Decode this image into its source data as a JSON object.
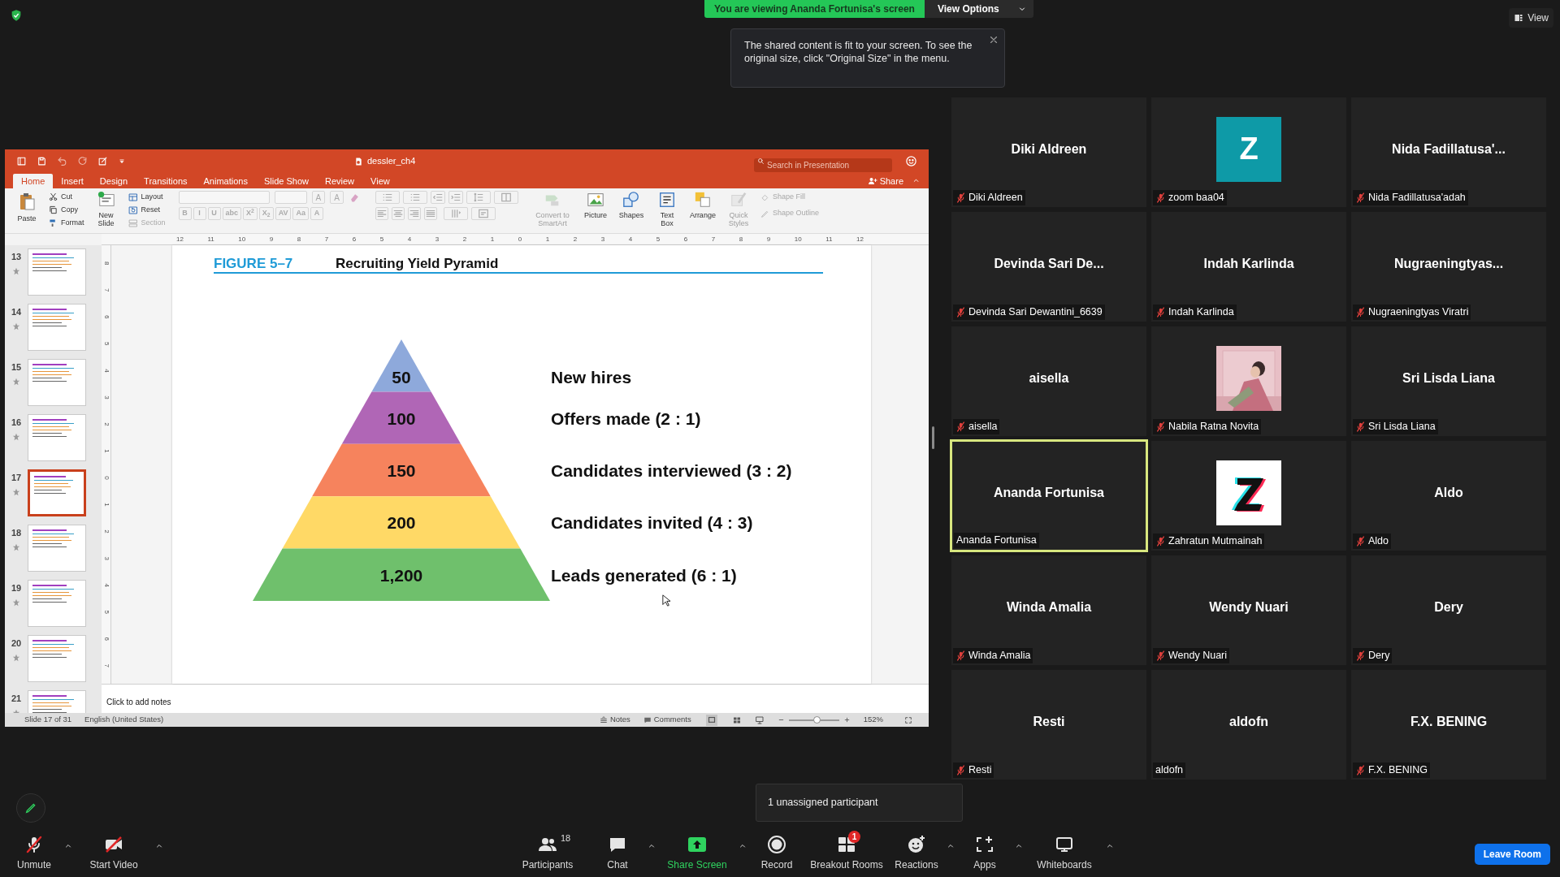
{
  "share_banner": {
    "text": "You are viewing Ananda Fortunisa's screen",
    "view_options": "View Options"
  },
  "notice": {
    "text": "The shared content is fit to your screen. To see the original size, click \"Original Size\" in the menu."
  },
  "view_button": "View",
  "presentation": {
    "title": "dessler_ch4",
    "search": {
      "placeholder": "Search in Presentation"
    },
    "tabs": [
      {
        "label": "Home",
        "selected": true
      },
      {
        "label": "Insert",
        "selected": false
      },
      {
        "label": "Design",
        "selected": false
      },
      {
        "label": "Transitions",
        "selected": false
      },
      {
        "label": "Animations",
        "selected": false
      },
      {
        "label": "Slide Show",
        "selected": false
      },
      {
        "label": "Review",
        "selected": false
      },
      {
        "label": "View",
        "selected": false
      }
    ],
    "share": "Share",
    "paste": "Paste",
    "clipboard": [
      {
        "label": "Cut",
        "kind": "cut"
      },
      {
        "label": "Copy",
        "kind": "copy"
      },
      {
        "label": "Format",
        "kind": "format"
      }
    ],
    "new_slide": "New Slide",
    "slide_items": [
      {
        "label": "Layout",
        "kind": "layout",
        "disabled": false
      },
      {
        "label": "Reset",
        "kind": "reset",
        "disabled": false
      },
      {
        "label": "Section",
        "kind": "section",
        "disabled": true
      }
    ],
    "size_buttons": [
      "A",
      "A"
    ],
    "format_buttons": [
      "B",
      "I",
      "U",
      "abc",
      "X$^{2}$",
      "X$_{2}$",
      "AV",
      "Aa",
      "A"
    ],
    "tools": [
      {
        "label": "Convert to SmartArt",
        "kind": "smartart",
        "disabled": true
      },
      {
        "label": "Picture",
        "kind": "picture",
        "disabled": false
      },
      {
        "label": "Shapes",
        "kind": "shapes",
        "disabled": false
      },
      {
        "label": "Text Box",
        "kind": "textbox",
        "disabled": false
      },
      {
        "label": "Arrange",
        "kind": "arrange",
        "disabled": false
      },
      {
        "label": "Quick Styles",
        "kind": "styles",
        "disabled": true
      }
    ],
    "shape_items": [
      {
        "label": "Shape Fill",
        "kind": "fill",
        "disabled": true
      },
      {
        "label": "Shape Outline",
        "kind": "outline",
        "disabled": true
      }
    ],
    "ruler": "12 11 10 9 8 7 6 5 4 3 2 1 0 1 2 3 4 5 6 7 8 9 10 11 12",
    "vertical_ruler": "8 7 6 5 4 3 2 1 0 1 2 3 4 5 6 7",
    "thumbnails": [
      {
        "number": "13",
        "selected": false
      },
      {
        "number": "14",
        "selected": false
      },
      {
        "number": "15",
        "selected": false
      },
      {
        "number": "16",
        "selected": false
      },
      {
        "number": "17",
        "selected": true
      },
      {
        "number": "18",
        "selected": false
      },
      {
        "number": "19",
        "selected": false
      },
      {
        "number": "20",
        "selected": false
      },
      {
        "number": "21",
        "selected": false
      }
    ],
    "slide": {
      "figure": "FIGURE 5–7",
      "title": "Recruiting Yield Pyramid",
      "levels": [
        {
          "value": "50",
          "label": "New hires",
          "color": "#8ea9db"
        },
        {
          "value": "100",
          "label": "Offers made (2 : 1)",
          "color": "#b066b6"
        },
        {
          "value": "150",
          "label": "Candidates interviewed (3 : 2)",
          "color": "#f6835d"
        },
        {
          "value": "200",
          "label": "Candidates invited (4 : 3)",
          "color": "#ffd966"
        },
        {
          "value": "1,200",
          "label": "Leads generated (6 : 1)",
          "color": "#6fc06c"
        }
      ]
    },
    "notes_placeholder": "Click to add notes",
    "status": {
      "slide": "Slide 17 of 31",
      "language": "English (United States)",
      "notes": "Notes",
      "comments": "Comments",
      "zoom_slider": {
        "level": 0.55
      },
      "zoom": "152%"
    }
  },
  "participants": [
    {
      "kind": "text",
      "display": "Diki Aldreen",
      "name": "Diki Aldreen",
      "muted": true,
      "speaking": false
    },
    {
      "kind": "letter",
      "letter": "Z",
      "name": "zoom baa04",
      "muted": true,
      "speaking": false
    },
    {
      "kind": "text",
      "display": "Nida Fadillatusa'...",
      "name": "Nida Fadillatusa'adah",
      "muted": true,
      "speaking": false
    },
    {
      "kind": "text",
      "display": "Devinda Sari De...",
      "name": "Devinda Sari Dewantini_6639",
      "muted": true,
      "speaking": false
    },
    {
      "kind": "text",
      "display": "Indah Karlinda",
      "name": "Indah Karlinda",
      "muted": true,
      "speaking": false
    },
    {
      "kind": "text",
      "display": "Nugraeningtyas...",
      "name": "Nugraeningtyas Viratri",
      "muted": true,
      "speaking": false
    },
    {
      "kind": "text",
      "display": "aisella",
      "name": "aisella",
      "muted": true,
      "speaking": false
    },
    {
      "name": "Nabila Ratna Novita",
      "muted": true,
      "speaking": false
    },
    {
      "kind": "text",
      "display": "Sri Lisda Liana",
      "name": "Sri Lisda Liana",
      "muted": true,
      "speaking": false
    },
    {
      "kind": "text",
      "display": "Ananda Fortunisa",
      "name": "Ananda Fortunisa",
      "muted": false,
      "speaking": true
    },
    {
      "kind": "logo",
      "name": "Zahratun Mutmainah",
      "muted": true,
      "speaking": false
    },
    {
      "kind": "text",
      "display": "Aldo",
      "name": "Aldo",
      "muted": true,
      "speaking": false
    },
    {
      "kind": "text",
      "display": "Winda Amalia",
      "name": "Winda Amalia",
      "muted": true,
      "speaking": false
    },
    {
      "kind": "text",
      "display": "Wendy Nuari",
      "name": "Wendy Nuari",
      "muted": true,
      "speaking": false
    },
    {
      "kind": "text",
      "display": "Dery",
      "name": "Dery",
      "muted": true,
      "speaking": false
    },
    {
      "kind": "text",
      "display": "Resti",
      "name": "Resti",
      "muted": true,
      "speaking": false
    },
    {
      "kind": "text",
      "display": "aldofn",
      "name": "aldofn",
      "muted": false,
      "speaking": false
    },
    {
      "kind": "text",
      "display": "F.X. BENING",
      "name": "F.X. BENING",
      "muted": true,
      "speaking": false
    }
  ],
  "breakout_tip": "1 unassigned participant",
  "toolbar": {
    "left": [
      {
        "label": "Unmute",
        "kind": "mic",
        "caret": true
      },
      {
        "label": "Start Video",
        "kind": "video",
        "caret": true
      }
    ],
    "center": [
      {
        "label": "Participants",
        "kind": "participants",
        "count": "18",
        "caret": false
      },
      {
        "label": "Chat",
        "kind": "chat",
        "caret": true
      },
      {
        "label": "Share Screen",
        "kind": "share",
        "caret": true
      },
      {
        "label": "Record",
        "kind": "record",
        "caret": false
      },
      {
        "label": "Breakout Rooms",
        "kind": "breakout",
        "badge": "1",
        "caret": false
      },
      {
        "label": "Reactions",
        "kind": "reactions",
        "caret": true
      },
      {
        "label": "Apps",
        "kind": "apps",
        "caret": true
      },
      {
        "label": "Whiteboards",
        "kind": "whiteboard",
        "caret": true
      }
    ],
    "leave": "Leave Room"
  }
}
